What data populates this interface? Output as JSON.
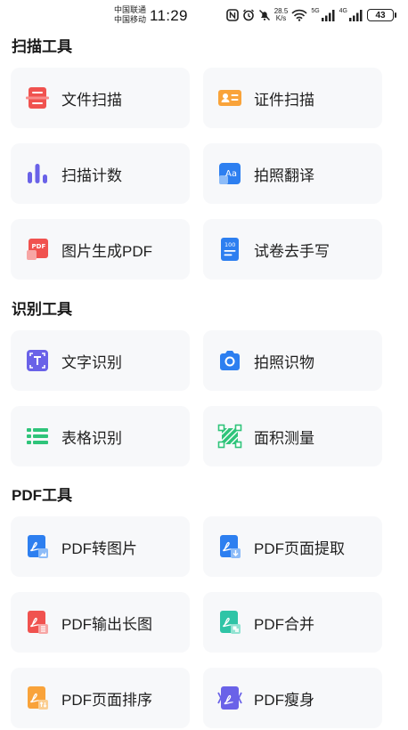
{
  "status_bar": {
    "carrier_1": "中国联通",
    "carrier_2": "中国移动",
    "time": "11:29",
    "speed_value": "28.5",
    "speed_unit": "K/s",
    "net_5g": "5G",
    "net_4g": "4G",
    "battery": "43"
  },
  "sections": {
    "scan": {
      "title": "扫描工具",
      "items": [
        {
          "label": "文件扫描",
          "icon": "document-scan-icon"
        },
        {
          "label": "证件扫描",
          "icon": "id-card-icon"
        },
        {
          "label": "扫描计数",
          "icon": "bar-count-icon"
        },
        {
          "label": "拍照翻译",
          "icon": "translate-icon"
        },
        {
          "label": "图片生成PDF",
          "icon": "image-to-pdf-icon"
        },
        {
          "label": "试卷去手写",
          "icon": "exam-paper-icon"
        }
      ]
    },
    "recognize": {
      "title": "识别工具",
      "items": [
        {
          "label": "文字识别",
          "icon": "text-recognition-icon"
        },
        {
          "label": "拍照识物",
          "icon": "camera-icon"
        },
        {
          "label": "表格识别",
          "icon": "table-icon"
        },
        {
          "label": "面积测量",
          "icon": "area-measure-icon"
        }
      ]
    },
    "pdf": {
      "title": "PDF工具",
      "items": [
        {
          "label": "PDF转图片",
          "icon": "pdf-to-image-icon"
        },
        {
          "label": "PDF页面提取",
          "icon": "pdf-extract-icon"
        },
        {
          "label": "PDF输出长图",
          "icon": "pdf-long-image-icon"
        },
        {
          "label": "PDF合并",
          "icon": "pdf-merge-icon"
        },
        {
          "label": "PDF页面排序",
          "icon": "pdf-sort-icon"
        },
        {
          "label": "PDF瘦身",
          "icon": "pdf-compress-icon"
        }
      ]
    }
  },
  "colors": {
    "card_bg": "#f7f8fa",
    "red": "#f0524f",
    "orange": "#f9a33a",
    "purple": "#6a62e8",
    "blue": "#2d7ff0",
    "green": "#2fc47a"
  }
}
